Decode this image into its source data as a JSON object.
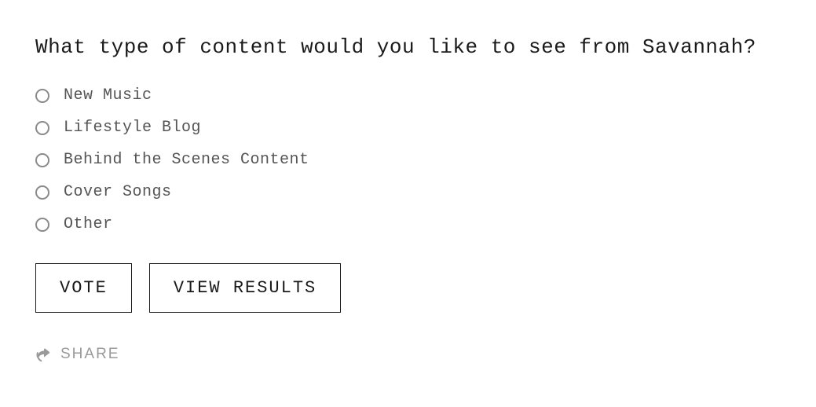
{
  "poll": {
    "question": "What type of content would you like to see from Savannah?",
    "options": [
      {
        "label": "New Music"
      },
      {
        "label": "Lifestyle Blog"
      },
      {
        "label": "Behind the Scenes Content"
      },
      {
        "label": "Cover Songs"
      },
      {
        "label": "Other"
      }
    ],
    "buttons": {
      "vote": "VOTE",
      "view_results": "VIEW RESULTS"
    },
    "share_label": "SHARE"
  }
}
